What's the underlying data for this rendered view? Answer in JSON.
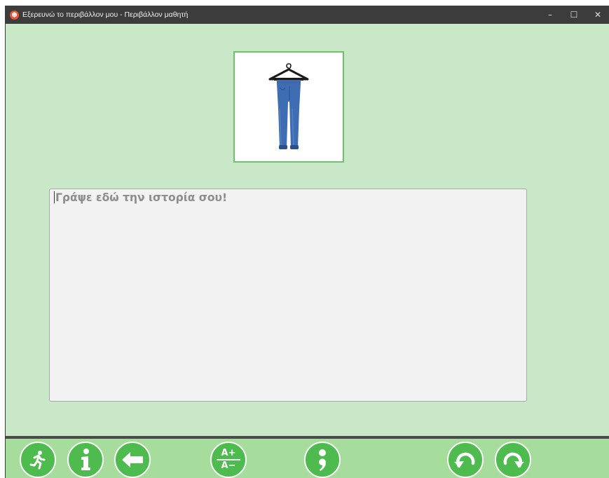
{
  "window": {
    "title": "Εξερευνώ το περιβάλλον μου - Περιβάλλον μαθητή",
    "controls": {
      "minimize": "–",
      "maximize": "☐",
      "close": "✕"
    }
  },
  "picture": {
    "subject": "pants-on-hanger"
  },
  "story": {
    "placeholder": "Γράψε εδώ την ιστορία σου!"
  },
  "toolbar": {
    "font_size": {
      "increase": "A+",
      "decrease": "A−"
    }
  },
  "colors": {
    "background": "#c8e8c8",
    "toolbar": "#a6dd9d",
    "button": "#4dbb4d",
    "frame_border": "#6cc36a",
    "titlebar": "#3c3c3c"
  }
}
